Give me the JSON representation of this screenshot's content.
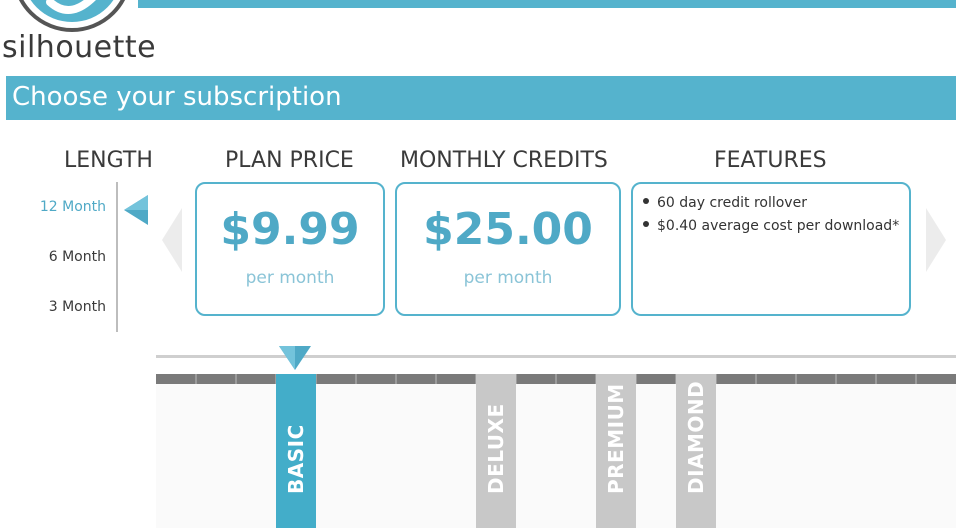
{
  "brand": {
    "name": "silhouette",
    "accent": "#55b3cd",
    "value_color": "#4fa9c6",
    "inactive_tier_color": "#c8c8c8"
  },
  "banner": {
    "title": "Choose your subscription"
  },
  "columns": {
    "length": "LENGTH",
    "plan_price": "PLAN PRICE",
    "monthly_credits": "MONTHLY CREDITS",
    "features": "FEATURES"
  },
  "length_options": [
    {
      "label": "12 Month",
      "selected": true
    },
    {
      "label": "6 Month",
      "selected": false
    },
    {
      "label": "3 Month",
      "selected": false
    }
  ],
  "plan_price": {
    "value": "$9.99",
    "unit": "per month"
  },
  "monthly_credits": {
    "value": "$25.00",
    "unit": "per month"
  },
  "features": [
    "60 day credit rollover",
    "$0.40 average cost per download*"
  ],
  "tiers": [
    {
      "label": "BASIC",
      "selected": true
    },
    {
      "label": "DELUXE",
      "selected": false
    },
    {
      "label": "PREMIUM",
      "selected": false
    },
    {
      "label": "DIAMOND",
      "selected": false
    }
  ],
  "icons": {
    "logo": "silhouette-logo-icon",
    "length_marker": "triangle-left-icon",
    "prev": "chevron-left-icon",
    "next": "chevron-right-icon",
    "slider_thumb": "triangle-down-icon"
  }
}
